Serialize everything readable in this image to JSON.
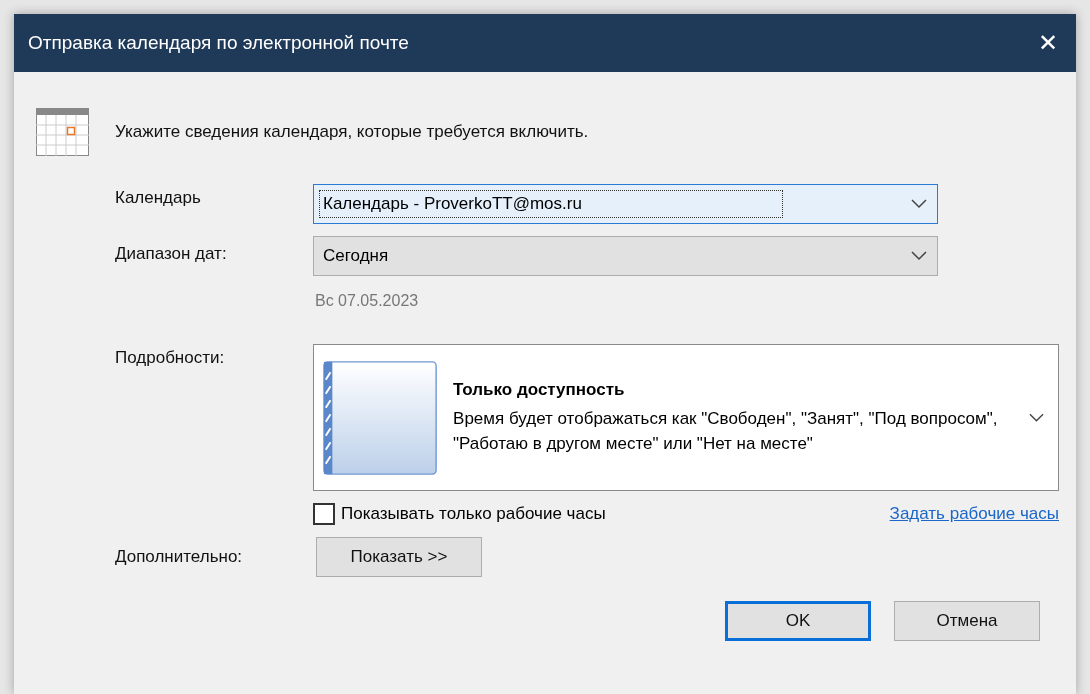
{
  "window": {
    "title": "Отправка календаря по электронной почте",
    "close": "✕"
  },
  "intro": "Укажите сведения календаря, которые требуется включить.",
  "fields": [
    {
      "label": "Календарь",
      "value": "Календарь - ProverkoTT@mos.ru",
      "focused": true
    },
    {
      "label": "Диапазон дат:",
      "value": "Сегодня",
      "focused": false
    }
  ],
  "date_note": "Вс 07.05.2023",
  "details": {
    "label": "Подробности:",
    "title": "Только доступность",
    "description": "Время будет отображаться как \"Свободен\", \"Занят\", \"Под вопросом\", \"Работаю в другом месте\" или \"Нет на месте\""
  },
  "working_hours": {
    "label": "Показывать только рабочие часы",
    "checked": false,
    "link": "Задать рабочие часы"
  },
  "advanced": {
    "label": "Дополнительно:",
    "button": "Показать >>"
  },
  "buttons": [
    {
      "label": "OK",
      "default": true
    },
    {
      "label": "Отмена",
      "default": false
    }
  ]
}
